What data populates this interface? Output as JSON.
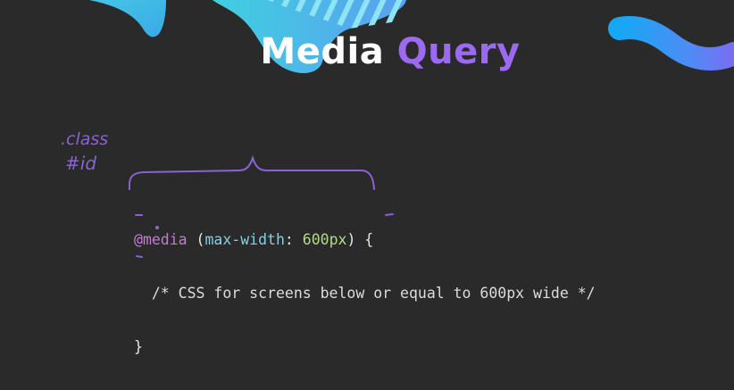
{
  "title": {
    "word1": "Media",
    "word2": "Query"
  },
  "code": {
    "at": "@",
    "media": "media",
    "open_paren": "(",
    "property": "max-width",
    "colon": ":",
    "value": "600px",
    "close_paren_brace": ") {",
    "comment": "/* CSS for screens below or equal to 600px wide */",
    "close_brace": "}"
  },
  "annotations": {
    "class_note": ".class",
    "id_note": "#id"
  },
  "colors": {
    "background": "#2a2a2a",
    "accent_purple": "#9b6af0",
    "ink_purple": "#8a63d2",
    "cyan": "#3fc4e8",
    "blue": "#2aa6f2"
  }
}
